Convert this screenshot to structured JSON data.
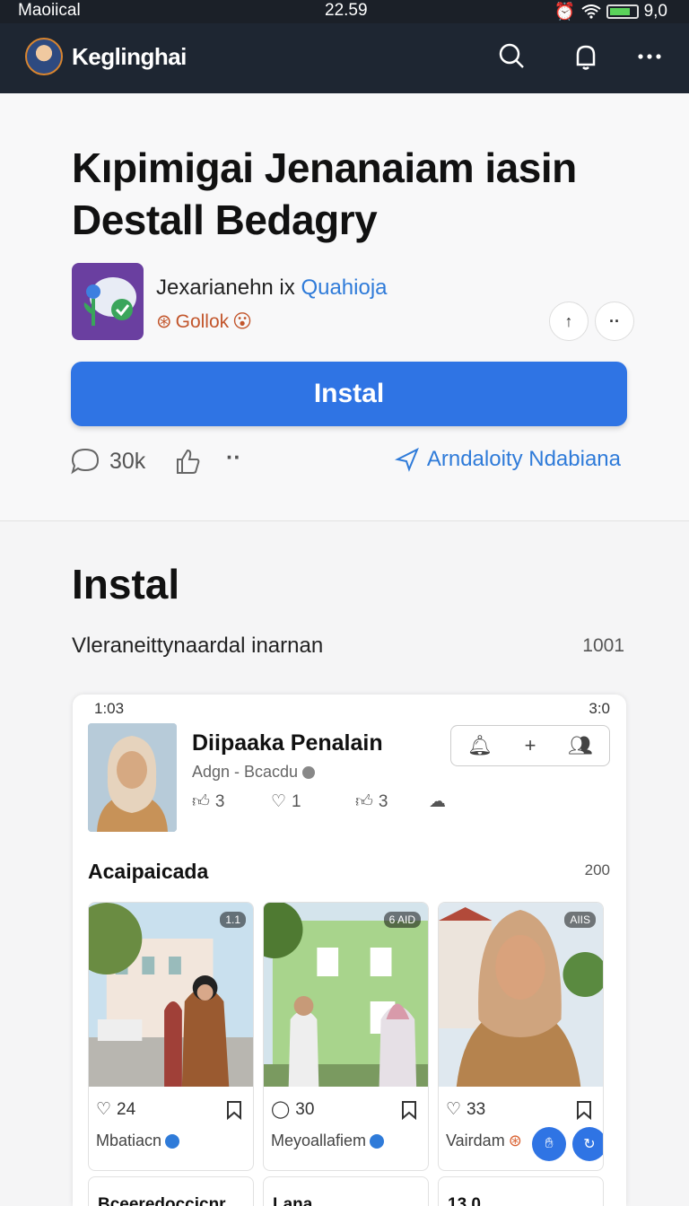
{
  "status_bar": {
    "carrier": "Maoiical",
    "time": "22.59",
    "battery": "9,0"
  },
  "app_bar": {
    "title": "Keglinghai"
  },
  "headline": {
    "line1": "Kıpimigai Jenanaiam iasin",
    "line2": "Destall Bedagry"
  },
  "publisher": {
    "name": "Jexarianehn ix",
    "link": "Quahioja",
    "rating_label": "Gollok"
  },
  "install_button": {
    "label": "Instal"
  },
  "meta": {
    "comments": "30k",
    "related_label": "Arndaloity Ndabiana"
  },
  "section": {
    "title": "Instal",
    "subtitle": "Vleraneittynaardal inarnan",
    "count": "1001"
  },
  "preview": {
    "status_time": "1:03",
    "status_right": "3:0",
    "profile_name": "Diipaaka Penalain",
    "profile_sub": "Adgn - Bcacdu",
    "stats": [
      "3",
      "1",
      "3"
    ],
    "section_title": "Acaipaicada",
    "section_count": "200",
    "tiles": [
      {
        "badge": "1.1",
        "likes": "24",
        "caption": "Mbatiacn"
      },
      {
        "badge": "6 AID",
        "likes": "30",
        "caption": "Meyoallafiem"
      },
      {
        "badge": "AIIS",
        "likes": "33",
        "caption": "Vairdam"
      }
    ],
    "row2": [
      "Bceeredoccicnr",
      "Lana",
      "13.0"
    ]
  },
  "colors": {
    "accent": "#2f74e4",
    "link": "#2f7bd9",
    "app_bar": "#1e2632"
  }
}
